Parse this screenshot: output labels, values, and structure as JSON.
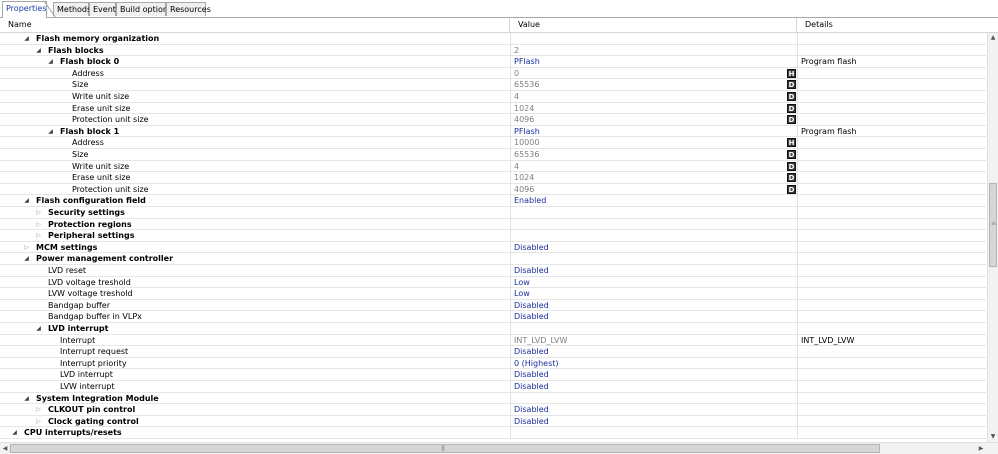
{
  "tabs": [
    {
      "label": "Properties",
      "active": true
    },
    {
      "label": "Methods",
      "active": false
    },
    {
      "label": "Events",
      "active": false
    },
    {
      "label": "Build options",
      "active": false
    },
    {
      "label": "Resources",
      "active": false
    }
  ],
  "columns": {
    "name": "Name",
    "value": "Value",
    "details": "Details"
  },
  "rows": [
    {
      "name": "Flash memory organization",
      "level": 1,
      "toggle": "expanded",
      "bold": true,
      "value": "",
      "value_style": "",
      "badge": "",
      "details": ""
    },
    {
      "name": "Flash blocks",
      "level": 2,
      "toggle": "expanded",
      "bold": true,
      "value": "2",
      "value_style": "gray",
      "badge": "",
      "details": ""
    },
    {
      "name": "Flash block 0",
      "level": 3,
      "toggle": "expanded",
      "bold": true,
      "value": "PFlash",
      "value_style": "blue",
      "badge": "",
      "details": "Program flash"
    },
    {
      "name": "Address",
      "level": 4,
      "toggle": "",
      "bold": false,
      "value": "0",
      "value_style": "gray",
      "badge": "H",
      "details": ""
    },
    {
      "name": "Size",
      "level": 4,
      "toggle": "",
      "bold": false,
      "value": "65536",
      "value_style": "gray",
      "badge": "D",
      "details": ""
    },
    {
      "name": "Write unit size",
      "level": 4,
      "toggle": "",
      "bold": false,
      "value": "4",
      "value_style": "gray",
      "badge": "D",
      "details": ""
    },
    {
      "name": "Erase unit size",
      "level": 4,
      "toggle": "",
      "bold": false,
      "value": "1024",
      "value_style": "gray",
      "badge": "D",
      "details": ""
    },
    {
      "name": "Protection unit size",
      "level": 4,
      "toggle": "",
      "bold": false,
      "value": "4096",
      "value_style": "gray",
      "badge": "D",
      "details": ""
    },
    {
      "name": "Flash block 1",
      "level": 3,
      "toggle": "expanded",
      "bold": true,
      "value": "PFlash",
      "value_style": "blue",
      "badge": "",
      "details": "Program flash"
    },
    {
      "name": "Address",
      "level": 4,
      "toggle": "",
      "bold": false,
      "value": "10000",
      "value_style": "gray",
      "badge": "H",
      "details": ""
    },
    {
      "name": "Size",
      "level": 4,
      "toggle": "",
      "bold": false,
      "value": "65536",
      "value_style": "gray",
      "badge": "D",
      "details": ""
    },
    {
      "name": "Write unit size",
      "level": 4,
      "toggle": "",
      "bold": false,
      "value": "4",
      "value_style": "gray",
      "badge": "D",
      "details": ""
    },
    {
      "name": "Erase unit size",
      "level": 4,
      "toggle": "",
      "bold": false,
      "value": "1024",
      "value_style": "gray",
      "badge": "D",
      "details": ""
    },
    {
      "name": "Protection unit size",
      "level": 4,
      "toggle": "",
      "bold": false,
      "value": "4096",
      "value_style": "gray",
      "badge": "D",
      "details": ""
    },
    {
      "name": "Flash configuration field",
      "level": 1,
      "toggle": "expanded",
      "bold": true,
      "value": "Enabled",
      "value_style": "blue",
      "badge": "",
      "details": ""
    },
    {
      "name": "Security settings",
      "level": 2,
      "toggle": "collapsed",
      "bold": true,
      "value": "",
      "value_style": "",
      "badge": "",
      "details": ""
    },
    {
      "name": "Protection regions",
      "level": 2,
      "toggle": "collapsed",
      "bold": true,
      "value": "",
      "value_style": "",
      "badge": "",
      "details": ""
    },
    {
      "name": "Peripheral settings",
      "level": 2,
      "toggle": "collapsed",
      "bold": true,
      "value": "",
      "value_style": "",
      "badge": "",
      "details": ""
    },
    {
      "name": "MCM settings",
      "level": 1,
      "toggle": "collapsed",
      "bold": true,
      "value": "Disabled",
      "value_style": "blue",
      "badge": "",
      "details": ""
    },
    {
      "name": "Power management controller",
      "level": 1,
      "toggle": "expanded",
      "bold": true,
      "value": "",
      "value_style": "",
      "badge": "",
      "details": ""
    },
    {
      "name": "LVD reset",
      "level": 2,
      "toggle": "",
      "bold": false,
      "value": "Disabled",
      "value_style": "blue",
      "badge": "",
      "details": ""
    },
    {
      "name": "LVD voltage treshold",
      "level": 2,
      "toggle": "",
      "bold": false,
      "value": "Low",
      "value_style": "blue",
      "badge": "",
      "details": ""
    },
    {
      "name": "LVW voltage treshold",
      "level": 2,
      "toggle": "",
      "bold": false,
      "value": "Low",
      "value_style": "blue",
      "badge": "",
      "details": ""
    },
    {
      "name": "Bandgap buffer",
      "level": 2,
      "toggle": "",
      "bold": false,
      "value": "Disabled",
      "value_style": "blue",
      "badge": "",
      "details": ""
    },
    {
      "name": "Bandgap buffer in VLPx",
      "level": 2,
      "toggle": "",
      "bold": false,
      "value": "Disabled",
      "value_style": "blue",
      "badge": "",
      "details": ""
    },
    {
      "name": "LVD interrupt",
      "level": 2,
      "toggle": "expanded",
      "bold": true,
      "value": "",
      "value_style": "",
      "badge": "",
      "details": ""
    },
    {
      "name": "Interrupt",
      "level": 3,
      "toggle": "",
      "bold": false,
      "value": "INT_LVD_LVW",
      "value_style": "gray",
      "badge": "",
      "details": "INT_LVD_LVW"
    },
    {
      "name": "Interrupt request",
      "level": 3,
      "toggle": "",
      "bold": false,
      "value": "Disabled",
      "value_style": "blue",
      "badge": "",
      "details": ""
    },
    {
      "name": "Interrupt priority",
      "level": 3,
      "toggle": "",
      "bold": false,
      "value": "0 (Highest)",
      "value_style": "blue",
      "badge": "",
      "details": ""
    },
    {
      "name": "LVD interrupt",
      "level": 3,
      "toggle": "",
      "bold": false,
      "value": "Disabled",
      "value_style": "blue",
      "badge": "",
      "details": ""
    },
    {
      "name": "LVW interrupt",
      "level": 3,
      "toggle": "",
      "bold": false,
      "value": "Disabled",
      "value_style": "blue",
      "badge": "",
      "details": ""
    },
    {
      "name": "System Integration Module",
      "level": 1,
      "toggle": "expanded",
      "bold": true,
      "value": "",
      "value_style": "",
      "badge": "",
      "details": ""
    },
    {
      "name": "CLKOUT pin control",
      "level": 2,
      "toggle": "collapsed",
      "bold": true,
      "value": "Disabled",
      "value_style": "blue",
      "badge": "",
      "details": ""
    },
    {
      "name": "Clock gating control",
      "level": 2,
      "toggle": "collapsed",
      "bold": true,
      "value": "Disabled",
      "value_style": "blue",
      "badge": "",
      "details": ""
    },
    {
      "name": "CPU interrupts/resets",
      "level": 0,
      "toggle": "expanded",
      "bold": true,
      "value": "",
      "value_style": "",
      "badge": "",
      "details": ""
    }
  ],
  "colors": {
    "value_blue": "#1a2f9a",
    "value_gray": "#808080",
    "badge_bg": "#3a3a3a"
  }
}
